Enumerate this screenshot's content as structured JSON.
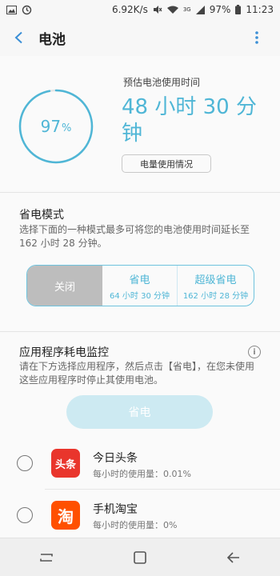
{
  "status_bar": {
    "net_speed": "6.92K/s",
    "signal_type": "3G",
    "battery": "97%",
    "time": "11:23",
    "icons": [
      "gallery-icon",
      "sync-icon",
      "mute-icon",
      "wifi-icon",
      "signal-icon",
      "battery-icon"
    ]
  },
  "header": {
    "title": "电池"
  },
  "battery": {
    "level_fraction": 0.97,
    "percent_value": "97",
    "percent_unit": "%",
    "estimate_label": "预估电池使用时间",
    "estimate_time": "48 小时 30 分钟",
    "usage_button": "电量使用情况"
  },
  "power_mode": {
    "title": "省电模式",
    "description": "选择下面的一种模式最多可将您的电池使用时间延长至 162 小时 28 分钟。",
    "options": [
      {
        "label": "关闭"
      },
      {
        "label": "省电",
        "sub": "64 小时 30 分钟"
      },
      {
        "label": "超级省电",
        "sub": "162 小时 28 分钟"
      }
    ],
    "selected": "关闭"
  },
  "app_monitor": {
    "title": "应用程序耗电监控",
    "description": "请在下方选择应用程序，然后点击【省电】，在您未使用这些应用程序时停止其使用电池。",
    "save_button": "省电",
    "apps": [
      {
        "name": "今日头条",
        "usage": "每小时的使用量：0.01%",
        "icon_text": "头条"
      },
      {
        "name": "手机淘宝",
        "usage": "每小时的使用量：0%",
        "icon_text": "淘"
      }
    ]
  },
  "colors": {
    "accent": "#4fb6d6",
    "toutiao_red": "#e9352c",
    "taobao_orange": "#ff5000"
  }
}
